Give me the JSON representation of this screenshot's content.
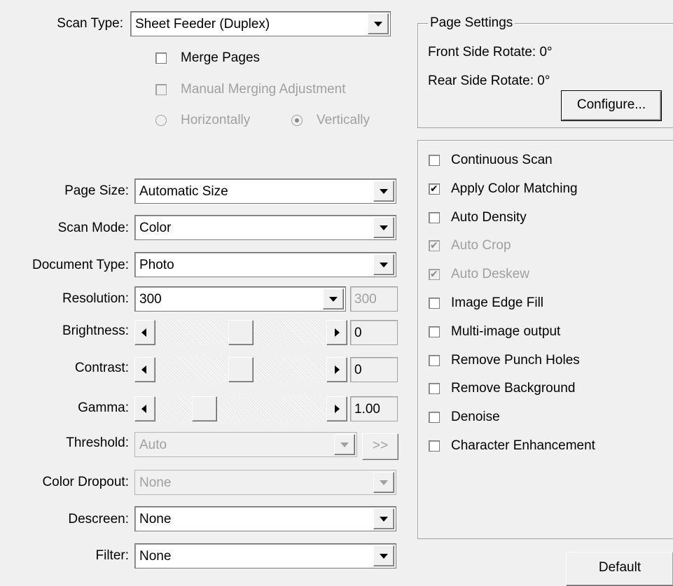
{
  "scan_type": {
    "label": "Scan Type:",
    "value": "Sheet Feeder (Duplex)"
  },
  "merge_pages": {
    "label": "Merge Pages",
    "checked": false
  },
  "manual_merging": {
    "label": "Manual Merging Adjustment",
    "checked": false,
    "disabled": true
  },
  "merge_direction": {
    "horizontal": {
      "label": "Horizontally",
      "selected": false
    },
    "vertical": {
      "label": "Vertically",
      "selected": true
    }
  },
  "page_settings": {
    "title": "Page Settings",
    "front_rotate": "Front Side Rotate: 0°",
    "rear_rotate": "Rear Side Rotate: 0°",
    "configure_button": "Configure..."
  },
  "page_size": {
    "label": "Page Size:",
    "value": "Automatic Size"
  },
  "scan_mode": {
    "label": "Scan Mode:",
    "value": "Color"
  },
  "document_type": {
    "label": "Document Type:",
    "value": "Photo"
  },
  "resolution": {
    "label": "Resolution:",
    "value": "300",
    "custom_value": "300"
  },
  "brightness": {
    "label": "Brightness:",
    "value": "0",
    "level": 0.5
  },
  "contrast": {
    "label": "Contrast:",
    "value": "0",
    "level": 0.5
  },
  "gamma": {
    "label": "Gamma:",
    "value": "1.00",
    "level": 0.25
  },
  "threshold": {
    "label": "Threshold:",
    "value": "Auto",
    "more_button": ">>"
  },
  "color_dropout": {
    "label": "Color Dropout:",
    "value": "None"
  },
  "descreen": {
    "label": "Descreen:",
    "value": "None"
  },
  "filter": {
    "label": "Filter:",
    "value": "None"
  },
  "options": [
    {
      "label": "Continuous Scan",
      "checked": false,
      "disabled": false
    },
    {
      "label": "Apply Color Matching",
      "checked": true,
      "disabled": false
    },
    {
      "label": "Auto Density",
      "checked": false,
      "disabled": false
    },
    {
      "label": "Auto Crop",
      "checked": true,
      "disabled": true
    },
    {
      "label": "Auto Deskew",
      "checked": true,
      "disabled": true
    },
    {
      "label": "Image Edge Fill",
      "checked": false,
      "disabled": false
    },
    {
      "label": "Multi-image output",
      "checked": false,
      "disabled": false
    },
    {
      "label": "Remove Punch Holes",
      "checked": false,
      "disabled": false
    },
    {
      "label": "Remove Background",
      "checked": false,
      "disabled": false
    },
    {
      "label": "Denoise",
      "checked": false,
      "disabled": false
    },
    {
      "label": "Character Enhancement",
      "checked": false,
      "disabled": false
    }
  ],
  "default_button": "Default"
}
